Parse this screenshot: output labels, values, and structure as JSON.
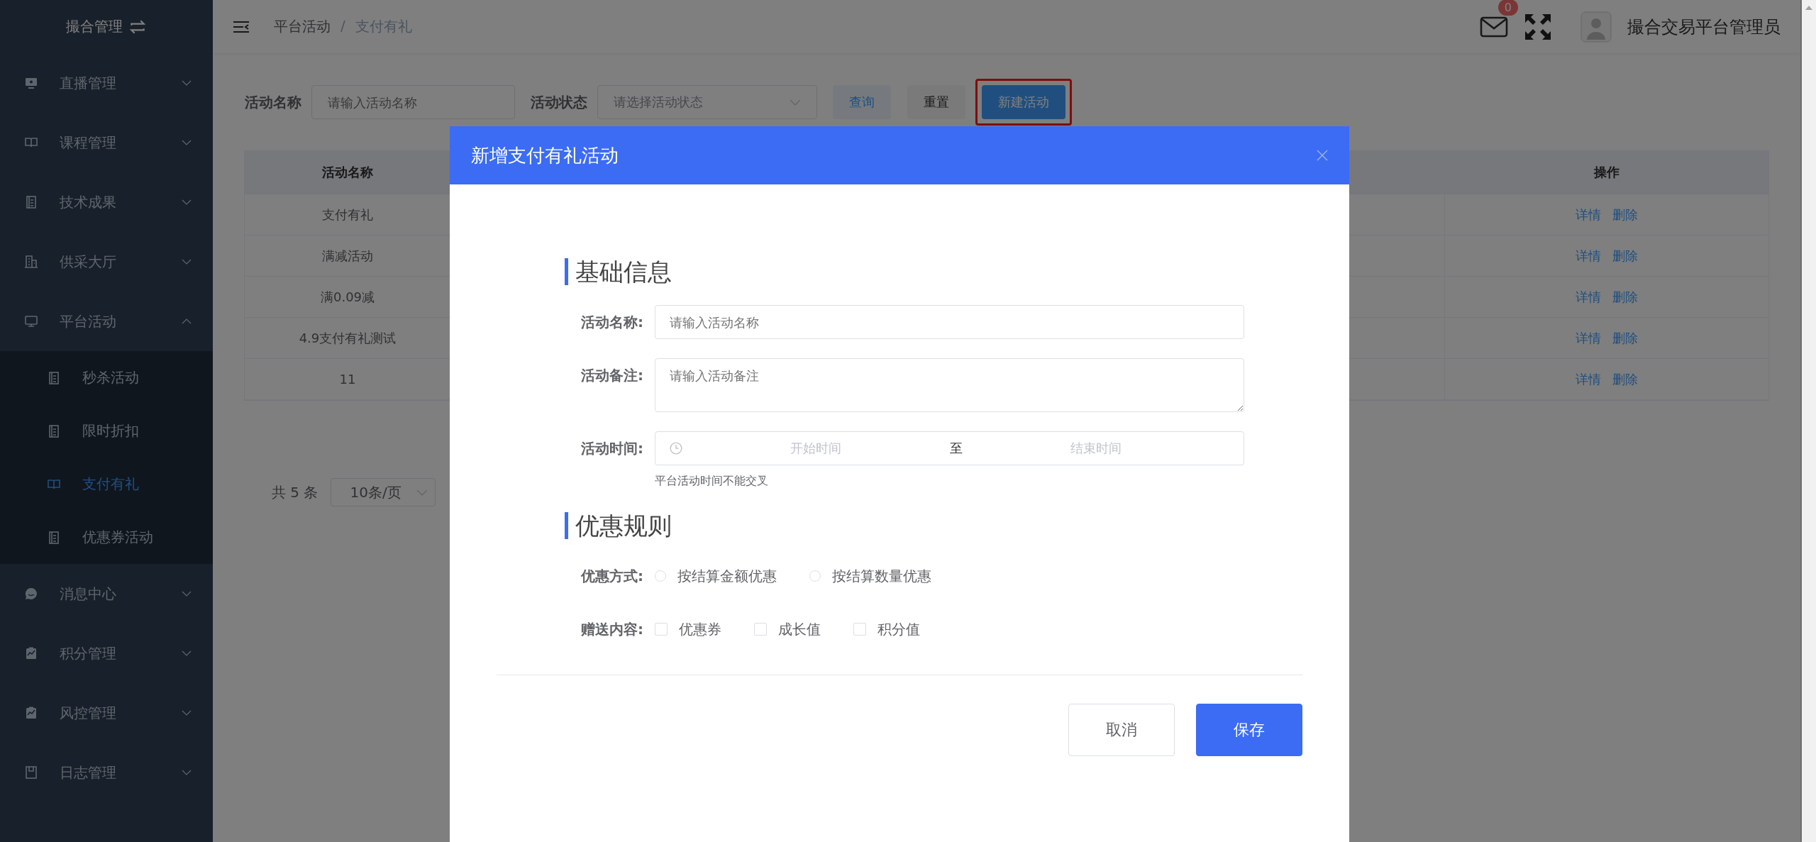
{
  "sidebar": {
    "title": "撮合管理",
    "items": [
      {
        "label": "直播管理",
        "expanded": false
      },
      {
        "label": "课程管理",
        "expanded": false
      },
      {
        "label": "技术成果",
        "expanded": false
      },
      {
        "label": "供采大厅",
        "expanded": false
      },
      {
        "label": "平台活动",
        "expanded": true,
        "children": [
          {
            "label": "秒杀活动",
            "selected": false
          },
          {
            "label": "限时折扣",
            "selected": false
          },
          {
            "label": "支付有礼",
            "selected": true
          },
          {
            "label": "优惠券活动",
            "selected": false
          }
        ]
      },
      {
        "label": "消息中心",
        "expanded": false
      },
      {
        "label": "积分管理",
        "expanded": false
      },
      {
        "label": "风控管理",
        "expanded": false
      },
      {
        "label": "日志管理",
        "expanded": false
      }
    ]
  },
  "header": {
    "breadcrumb": [
      "平台活动",
      "支付有礼"
    ],
    "separator": "/",
    "badge": "0",
    "user": "撮合交易平台管理员"
  },
  "filters": {
    "fields": [
      {
        "kind": "input",
        "label": "活动名称",
        "placeholder": "请输入活动名称"
      },
      {
        "kind": "select",
        "label": "活动状态",
        "placeholder": "请选择活动状态"
      }
    ],
    "buttons": [
      {
        "kind": "query",
        "label": "查询"
      },
      {
        "kind": "reset",
        "label": "重置"
      },
      {
        "kind": "primary",
        "label": "新建活动",
        "highlighted": true
      }
    ]
  },
  "table": {
    "columns": [
      "活动名称",
      "操作"
    ],
    "rows": [
      {
        "name": "支付有礼",
        "actions": [
          "详情",
          "删除"
        ]
      },
      {
        "name": "满减活动",
        "actions": [
          "详情",
          "删除"
        ]
      },
      {
        "name": "满0.09减",
        "actions": [
          "详情",
          "删除"
        ]
      },
      {
        "name": "4.9支付有礼测试",
        "actions": [
          "详情",
          "删除"
        ]
      },
      {
        "name": "11",
        "actions": [
          "详情",
          "删除"
        ]
      }
    ]
  },
  "pagination": {
    "total": "共 5 条",
    "page_size": "10条/页"
  },
  "dialog": {
    "title": "新增支付有礼活动",
    "sections": [
      {
        "title": "基础信息",
        "fields": [
          {
            "kind": "input",
            "label": "活动名称:",
            "placeholder": "请输入活动名称"
          },
          {
            "kind": "textarea",
            "label": "活动备注:",
            "placeholder": "请输入活动备注"
          },
          {
            "kind": "daterange",
            "label": "活动时间:",
            "start_placeholder": "开始时间",
            "separator": "至",
            "end_placeholder": "结束时间",
            "hint": "平台活动时间不能交叉"
          }
        ]
      },
      {
        "title": "优惠规则",
        "fields": [
          {
            "kind": "radio",
            "label": "优惠方式:",
            "options": [
              {
                "label": "按结算金额优惠",
                "selected": false
              },
              {
                "label": "按结算数量优惠",
                "selected": false
              }
            ]
          },
          {
            "kind": "checkbox",
            "label": "赠送内容:",
            "options": [
              {
                "label": "优惠券",
                "checked": false
              },
              {
                "label": "成长值",
                "checked": false
              },
              {
                "label": "积分值",
                "checked": false
              }
            ]
          }
        ]
      }
    ],
    "buttons": [
      {
        "kind": "cancel",
        "label": "取消"
      },
      {
        "kind": "primary",
        "label": "保存"
      }
    ]
  }
}
